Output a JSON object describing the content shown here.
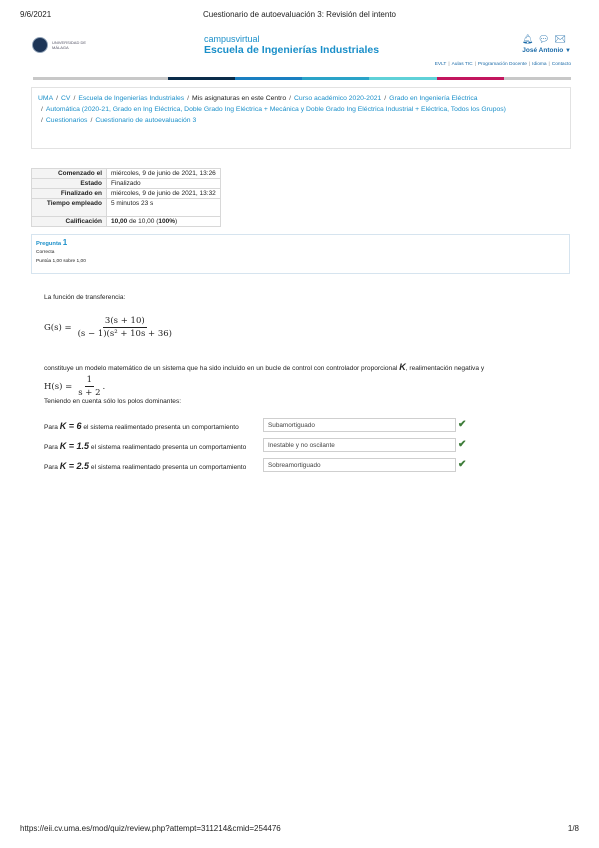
{
  "print_header": {
    "date": "9/6/2021",
    "title": "Cuestionario de autoevaluación 3: Revisión del intento"
  },
  "site": {
    "logo_text": "UNIVERSIDAD DE MÁLAGA",
    "brand_sub": "campusvirtual",
    "brand_main": "Escuela de Ingenierías Industriales",
    "user_name": "José Antonio",
    "icons": [
      "bell-icon",
      "chat-icon",
      "envelope-icon"
    ],
    "quick_links": [
      "EVLT",
      "Aulas TIC",
      "Programación Docente",
      "Idioma",
      "Contacto"
    ],
    "color_bar": [
      "#c8c8c8",
      "#c8c8c8",
      "#0b2c4a",
      "#1a7fc1",
      "#2aa3c8",
      "#5fd1d8",
      "#c2165e",
      "#c8c8c8"
    ]
  },
  "breadcrumb": {
    "items": [
      "UMA",
      "CV",
      "Escuela de Ingenierías Industriales",
      "Mis asignaturas en este Centro",
      "Curso académico 2020-2021",
      "Grado en Ingeniería Eléctrica",
      "Automática (2020-21, Grado en Ing Eléctrica, Doble Grado Ing Eléctrica + Mecánica y Doble Grado Ing Eléctrica Industrial + Eléctrica, Todos los Grupos)",
      "Cuestionarios",
      "Cuestionario de autoevaluación 3"
    ]
  },
  "summary": [
    {
      "label": "Comenzado el",
      "value": "miércoles, 9 de junio de 2021, 13:26"
    },
    {
      "label": "Estado",
      "value": "Finalizado"
    },
    {
      "label": "Finalizado en",
      "value": "miércoles, 9 de junio de 2021, 13:32"
    },
    {
      "label": "Tiempo empleado",
      "value": "5 minutos 23 s"
    },
    {
      "label": "Calificación",
      "value_bold": "10,00",
      "value_rest": " de 10,00 (",
      "value_pct": "100%",
      "value_end": ")"
    }
  ],
  "question": {
    "label": "Pregunta",
    "number": "1",
    "state": "Correcta",
    "grade": "Puntúa 1,00 sobre 1,00",
    "intro": "La función de transferencia:",
    "G_lhs": "G(s) =",
    "G_num": "3(s + 10)",
    "G_den": "(s − 1)(s² + 10s + 36)",
    "sentence_pre": "constituye un modelo matemático de un sistema que ha sido incluido en un bucle de control con controlador proporcional",
    "sentence_K": "K",
    "sentence_post": ", realimentación negativa y",
    "H_lhs": "H(s) =",
    "H_num": "1",
    "H_den": "s + 2",
    "H_end": ".",
    "poles_note": "Teniendo en cuenta sólo los polos dominantes:",
    "rows": [
      {
        "pre": "Para",
        "K": "K = 6",
        "post": "el sistema realimentado presenta un comportamiento",
        "answer": "Subamortiguado"
      },
      {
        "pre": "Para",
        "K": "K = 1.5",
        "post": "el sistema realimentado presenta un comportamiento",
        "answer": "Inestable y no oscilante"
      },
      {
        "pre": "Para",
        "K": "K = 2.5",
        "post": "el sistema realimentado presenta un comportamiento",
        "answer": "Sobreamortiguado"
      }
    ]
  },
  "print_footer": {
    "url": "https://eii.cv.uma.es/mod/quiz/review.php?attempt=311214&cmid=254476",
    "page": "1/8"
  }
}
